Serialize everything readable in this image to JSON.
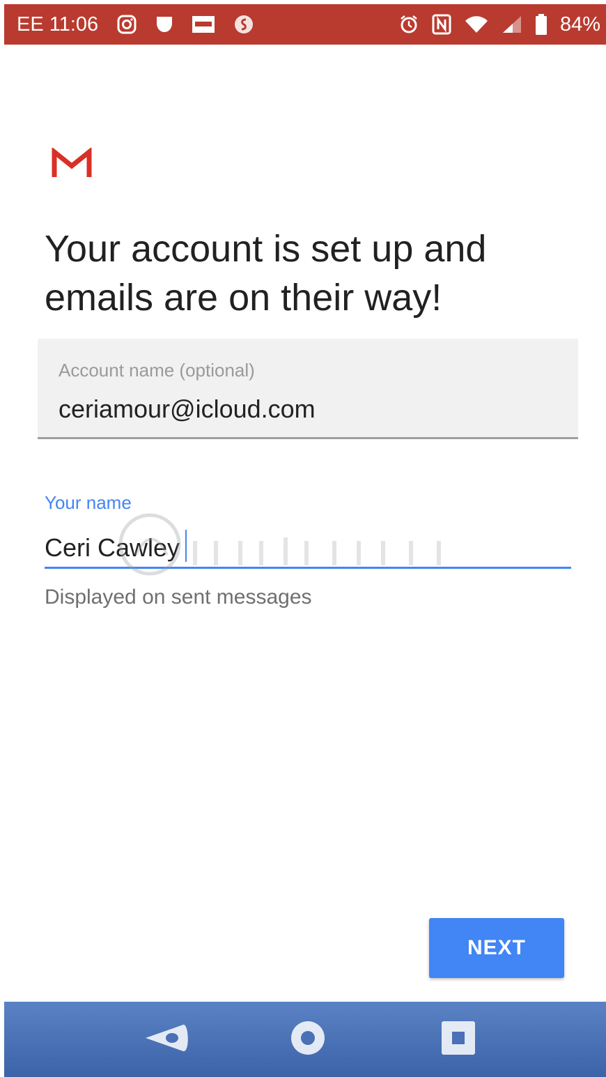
{
  "status_bar": {
    "carrier": "EE",
    "time": "11:06",
    "battery": "84%",
    "background": "#b93a2f",
    "left_icons": [
      "instagram-icon",
      "pocket-icon",
      "news-app-icon",
      "shazam-icon"
    ],
    "right_icons": [
      "alarm-icon",
      "nfc-icon",
      "wifi-icon",
      "signal-icon",
      "battery-icon"
    ]
  },
  "app": {
    "logo": "gmail-logo",
    "headline": "Your account is set up and emails are on their way!"
  },
  "account_field": {
    "label": "Account name (optional)",
    "value": "ceriamour@icloud.com"
  },
  "name_field": {
    "label": "Your name",
    "value": "Ceri Cawley",
    "helper": "Displayed on sent messages"
  },
  "actions": {
    "next_label": "NEXT"
  },
  "nav_bar": {
    "buttons": [
      "back-icon",
      "home-icon",
      "recents-icon"
    ]
  },
  "colors": {
    "accent": "#4285f4",
    "gmail_red": "#d93025"
  }
}
